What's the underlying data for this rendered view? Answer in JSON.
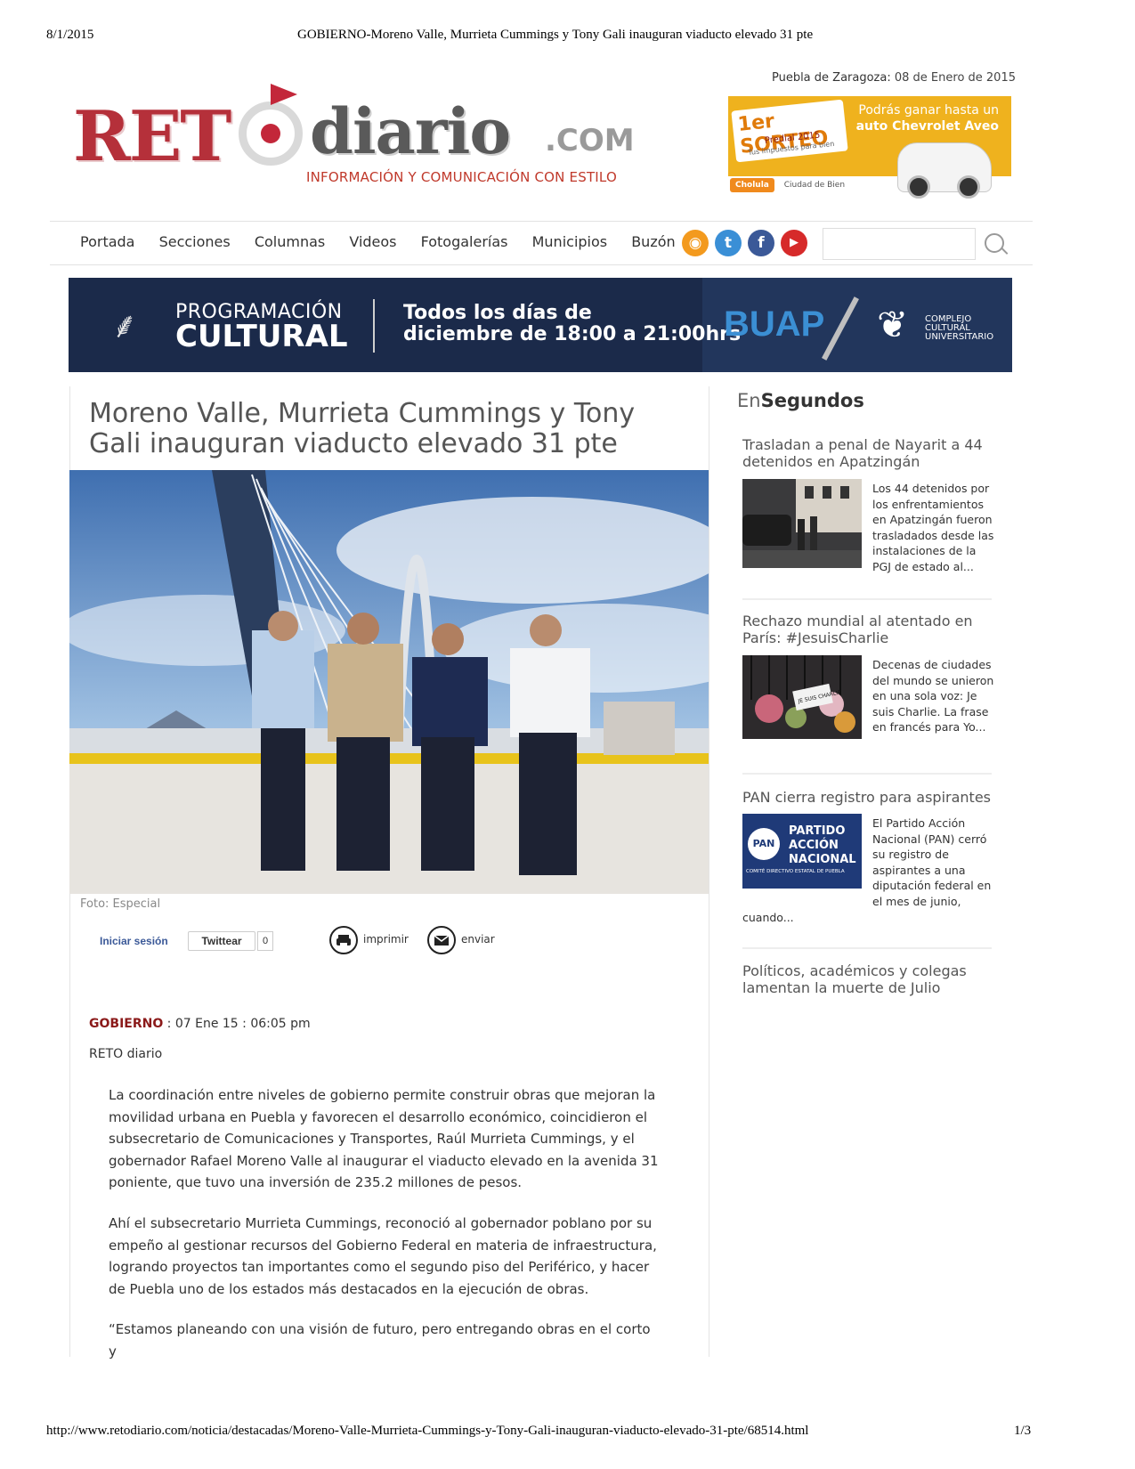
{
  "print_header": {
    "date": "8/1/2015",
    "doc_title": "GOBIERNO-Moreno Valle, Murrieta Cummings y Tony Gali inauguran viaducto elevado 31 pte"
  },
  "print_footer": {
    "url": "http://www.retodiario.com/noticia/destacadas/Moreno-Valle-Murrieta-Cummings-y-Tony-Gali-inauguran-viaducto-elevado-31-pte/68514.html",
    "page": "1/3"
  },
  "dateline": {
    "city": "Puebla de Zaragoza:",
    "date": "08 de Enero de 2015"
  },
  "logo": {
    "ret": "RET",
    "diario": "diario",
    "com": ".COM",
    "tagline": "INFORMACIÓN Y COMUNICACIÓN CON ESTILO"
  },
  "ad": {
    "sorteo": "1er SORTEO",
    "predial": "Predial 2015",
    "lema": "Tus impuestos para bien",
    "line1": "Podrás ganar hasta un",
    "line2": "auto Chevrolet Aveo",
    "logo1": "Cholula",
    "logo2": "Ciudad de Bien"
  },
  "nav": [
    "Portada",
    "Secciones",
    "Columnas",
    "Videos",
    "Fotogalerías",
    "Municipios",
    "Buzón"
  ],
  "social": [
    {
      "icon": "rss-icon",
      "glyph": "◉",
      "color": "#f39a1e"
    },
    {
      "icon": "twitter-icon",
      "glyph": "t",
      "color": "#3a8fd6"
    },
    {
      "icon": "facebook-icon",
      "glyph": "f",
      "color": "#3b5998"
    },
    {
      "icon": "youtube-icon",
      "glyph": "▶",
      "color": "#d62a2a"
    }
  ],
  "banner": {
    "line1": "PROGRAMACIÓN",
    "line2": "CULTURAL",
    "line3": "Todos los días de",
    "line4": "diciembre de 18:00 a 21:00hrs",
    "buap": "BUAP",
    "ccu": [
      "COMPLEJO",
      "CULTURAL",
      "UNIVERSITARIO"
    ]
  },
  "article": {
    "title": "Moreno Valle, Murrieta Cummings y Tony Gali inauguran viaducto elevado 31 pte",
    "caption": "Foto: Especial",
    "login": "Iniciar sesión",
    "tweet": "Twittear",
    "tweet_count": "0",
    "print": "imprimir",
    "send": "enviar",
    "section": "GOBIERNO",
    "date": " : 07 Ene 15 : 06:05 pm",
    "author": "RETO diario",
    "paragraphs": [
      "La coordinación entre niveles de gobierno permite construir obras que mejoran la movilidad urbana en Puebla y favorecen el desarrollo económico, coincidieron el subsecretario de Comunicaciones y Transportes, Raúl Murrieta Cummings, y el gobernador Rafael Moreno Valle al inaugurar el viaducto elevado en la avenida 31 poniente, que tuvo una inversión de 235.2 millones de pesos.",
      "Ahí el subsecretario Murrieta Cummings, reconoció al gobernador poblano por su empeño al gestionar recursos del Gobierno Federal en materia de infraestructura, logrando proyectos tan importantes como el segundo piso del Periférico, y hacer de Puebla uno de los estados más destacados en la ejecución de obras.",
      "“Estamos planeando con una visión de futuro, pero entregando obras en el corto y"
    ]
  },
  "sidebar": {
    "head_light": "En",
    "head_bold": "Segundos",
    "items": [
      {
        "title": "Trasladan a penal de Nayarit a 44 detenidos en Apatzingán",
        "text": "Los 44 detenidos por los enfrentamientos en Apatzingán fueron trasladados desde las instalaciones de la PGJ de estado al..."
      },
      {
        "title": "Rechazo mundial al atentado en París: #JesuisCharlie",
        "text": "Decenas de ciudades del mundo se unieron en una sola voz: Je suis Charlie. La frase en francés para Yo..."
      },
      {
        "title": "PAN cierra registro para aspirantes",
        "text": "El Partido Acción Nacional (PAN) cerró su registro de aspirantes a una diputación federal en el mes de junio,",
        "text_cont": "cuando...",
        "pan_logo": [
          "PARTIDO",
          "ACCIÓN",
          "NACIONAL"
        ],
        "pan_abbr": "PAN",
        "pan_sub": "COMITÉ DIRECTIVO ESTATAL DE PUEBLA",
        "charlie": "JE SUIS CHARLIE"
      },
      {
        "title": "Políticos, académicos y colegas lamentan la muerte de Julio"
      }
    ]
  }
}
